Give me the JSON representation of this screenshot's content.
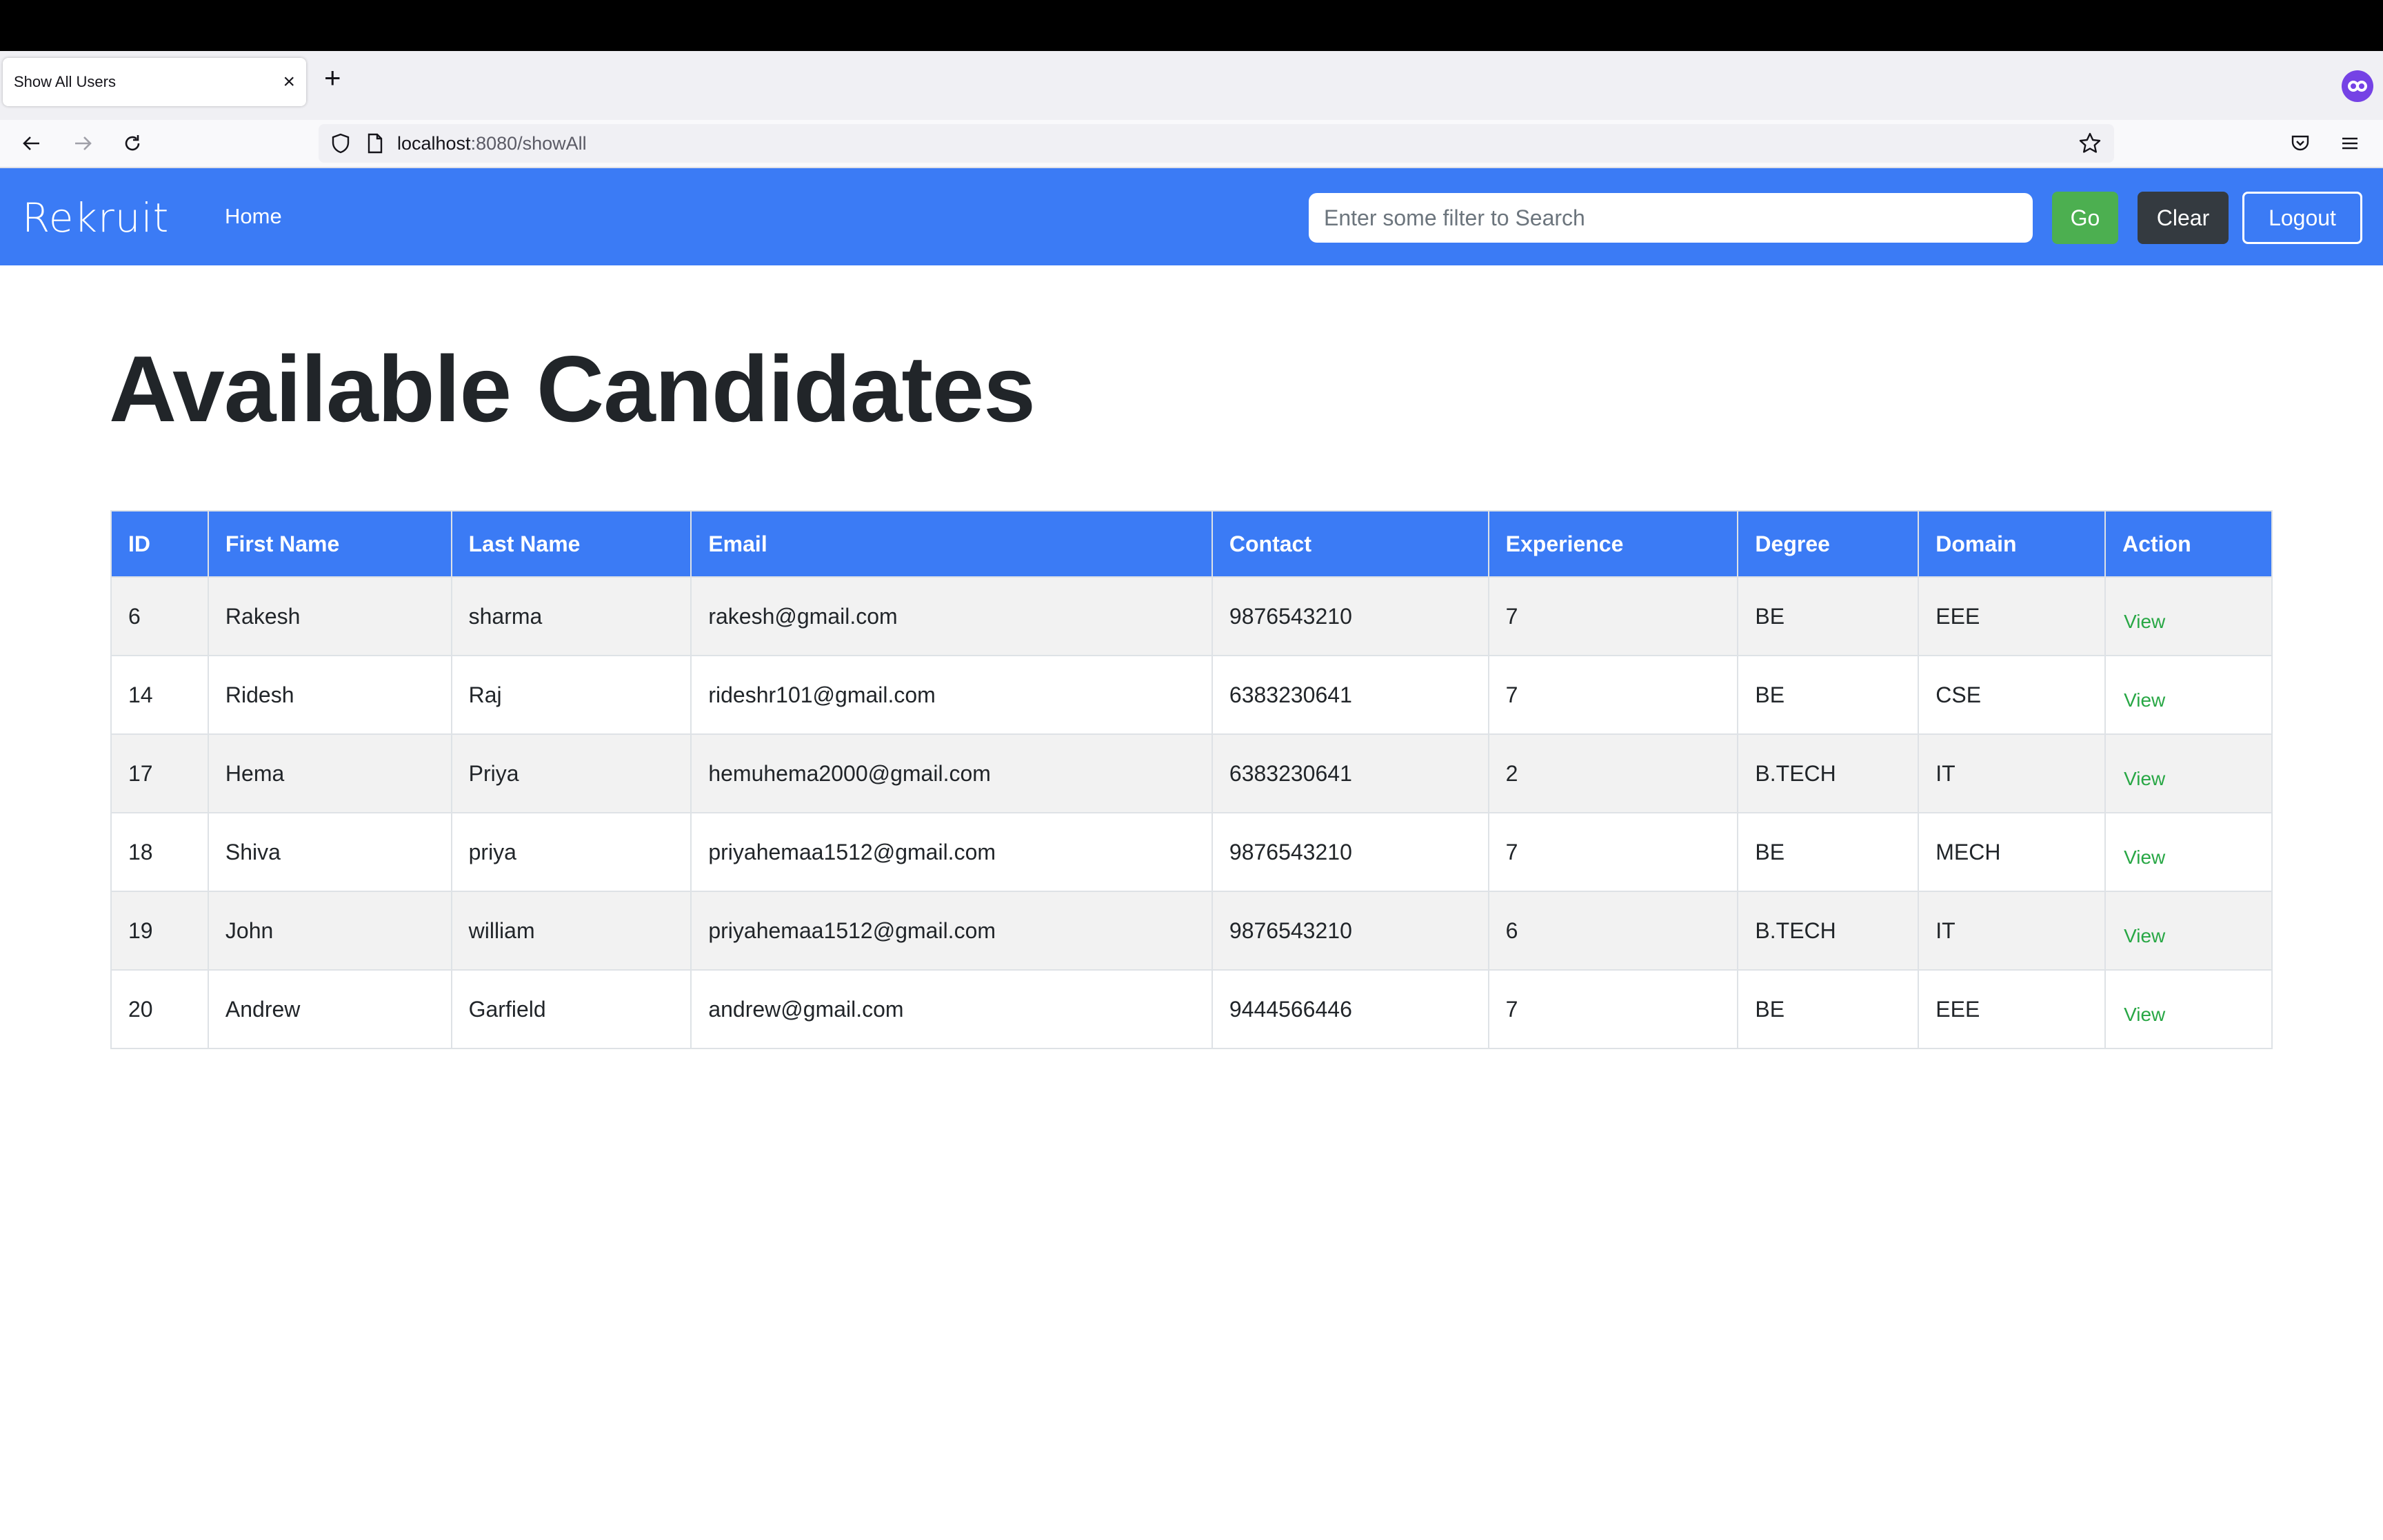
{
  "browser": {
    "tab_title": "Show All Users",
    "tab_close": "×",
    "new_tab": "+",
    "url_host": "localhost",
    "url_rest": ":8080/showAll"
  },
  "navbar": {
    "brand": "Rekruit",
    "home": "Home",
    "search_placeholder": "Enter some filter to Search",
    "search_value": "",
    "go": "Go",
    "clear": "Clear",
    "logout": "Logout",
    "accent_color": "#3b7bf5"
  },
  "page": {
    "title": "Available Candidates"
  },
  "table": {
    "headers": [
      "ID",
      "First Name",
      "Last Name",
      "Email",
      "Contact",
      "Experience",
      "Degree",
      "Domain",
      "Action"
    ],
    "rows": [
      {
        "id": "6",
        "first": "Rakesh",
        "last": "sharma",
        "email": "rakesh@gmail.com",
        "contact": "9876543210",
        "experience": "7",
        "degree": "BE",
        "domain": "EEE",
        "action": "View"
      },
      {
        "id": "14",
        "first": "Ridesh",
        "last": "Raj",
        "email": "rideshr101@gmail.com",
        "contact": "6383230641",
        "experience": "7",
        "degree": "BE",
        "domain": "CSE",
        "action": "View"
      },
      {
        "id": "17",
        "first": "Hema",
        "last": "Priya",
        "email": "hemuhema2000@gmail.com",
        "contact": "6383230641",
        "experience": "2",
        "degree": "B.TECH",
        "domain": "IT",
        "action": "View"
      },
      {
        "id": "18",
        "first": "Shiva",
        "last": "priya",
        "email": "priyahemaa1512@gmail.com",
        "contact": "9876543210",
        "experience": "7",
        "degree": "BE",
        "domain": "MECH",
        "action": "View"
      },
      {
        "id": "19",
        "first": "John",
        "last": "william",
        "email": "priyahemaa1512@gmail.com",
        "contact": "9876543210",
        "experience": "6",
        "degree": "B.TECH",
        "domain": "IT",
        "action": "View"
      },
      {
        "id": "20",
        "first": "Andrew",
        "last": "Garfield",
        "email": "andrew@gmail.com",
        "contact": "9444566446",
        "experience": "7",
        "degree": "BE",
        "domain": "EEE",
        "action": "View"
      }
    ]
  }
}
